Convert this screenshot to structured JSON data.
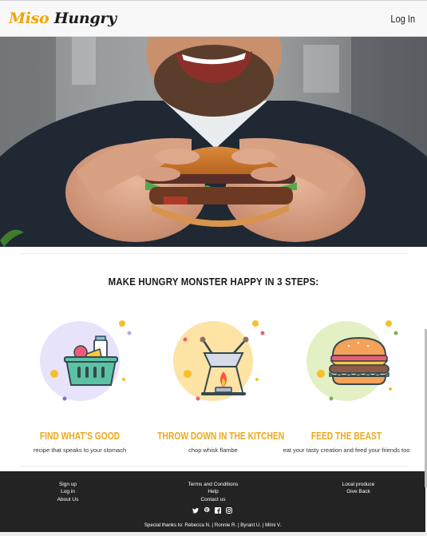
{
  "header": {
    "brand_part1": "Miso",
    "brand_part2": "Hungry",
    "login_label": "Log In"
  },
  "steps": {
    "heading": "MAKE HUNGRY MONSTER HAPPY IN 3 STEPS:",
    "items": [
      {
        "title": "FIND WHAT'S GOOD",
        "description": "recipe that speaks to your stomach",
        "icon": "basket-icon",
        "circle_color": "#e7e3fb"
      },
      {
        "title": "THROW DOWN IN THE KITCHEN",
        "description": "chop whisk flambe",
        "icon": "fondue-icon",
        "circle_color": "#fde3a4"
      },
      {
        "title": "FEED THE BEAST",
        "description": "eat your tasty creation and feed your friends too",
        "icon": "burger-icon",
        "circle_color": "#e3f0c3"
      }
    ]
  },
  "footer": {
    "col1": [
      "Sign up",
      "Log in",
      "About Us"
    ],
    "col2": [
      "Terms and Conditions",
      "Help",
      "Contact us"
    ],
    "col3": [
      "Local produce",
      "Give Back"
    ],
    "social_icons": [
      "twitter-icon",
      "pinterest-icon",
      "facebook-icon",
      "instagram-icon"
    ],
    "thanks": "Special thanks to: Rebecca N. | Ronnie R. | Byrant U. | Mimi V."
  },
  "colors": {
    "accent": "#eda81a",
    "footer_bg": "#232323",
    "header_bg": "#f8f8f8"
  }
}
